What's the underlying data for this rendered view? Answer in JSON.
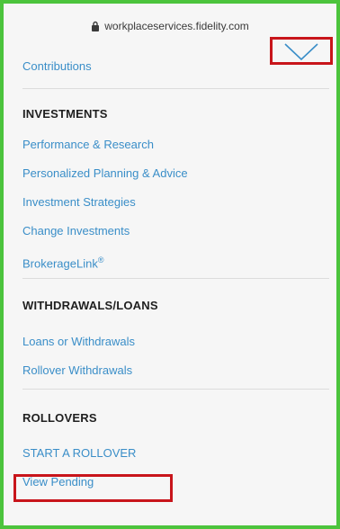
{
  "browser": {
    "url": "workplaceservices.fidelity.com"
  },
  "menu": {
    "top_link": "Contributions",
    "sections": [
      {
        "heading": "INVESTMENTS",
        "links": [
          "Performance & Research",
          "Personalized Planning & Advice",
          "Investment Strategies",
          "Change Investments",
          "BrokerageLink"
        ],
        "registered_mark": "®"
      },
      {
        "heading": "WITHDRAWALS/LOANS",
        "links": [
          "Loans or Withdrawals",
          "Rollover Withdrawals"
        ]
      },
      {
        "heading": "ROLLOVERS",
        "links": [
          "START A ROLLOVER",
          "View Pending"
        ]
      }
    ]
  },
  "icons": {
    "collapse": "chevron-down-icon",
    "lock": "lock-icon"
  },
  "colors": {
    "link": "#3a8ec8",
    "highlight": "#c8151b",
    "frame_border": "#4cc43c",
    "background": "#f6f6f6"
  }
}
